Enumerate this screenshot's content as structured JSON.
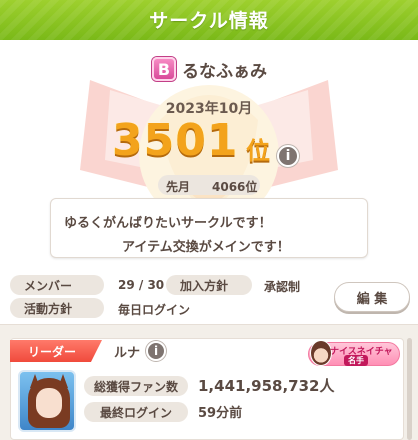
{
  "header": {
    "title": "サークル情報"
  },
  "circle": {
    "rank_letter": "B",
    "name": "るなふぁみ",
    "month": "2023年10月",
    "rank": "3501",
    "rank_suffix": "位",
    "info_glyph": "i",
    "last_month_label": "先月",
    "last_month_value": "4066位",
    "intro_line1": "ゆるくがんばりたいサークルです！",
    "intro_line2": "アイテム交換がメインです！"
  },
  "stats": {
    "member_label": "メンバー",
    "member_value": "29 / 30",
    "join_label": "加入方針",
    "join_value": "承認制",
    "activity_label": "活動方針",
    "activity_value": "毎日ログイン",
    "edit_label": "編 集"
  },
  "leader": {
    "tag": "リーダー",
    "name": "ルナ",
    "info_glyph": "i",
    "title_top": "ナイスネイチャ",
    "title_sub": "名手",
    "fans_label": "総獲得ファン数",
    "fans_value": "1,441,958,732人",
    "login_label": "最終ログイン",
    "login_value": "59分前"
  },
  "icons": {
    "emblem": "horse-emblem-icon",
    "info": "info-icon",
    "avatar": "character-avatar"
  },
  "colors": {
    "header": "#8bc623",
    "rank": "#f3a31c",
    "leader_tag": "#f04a3c",
    "rank_badge": "#e0559f"
  }
}
